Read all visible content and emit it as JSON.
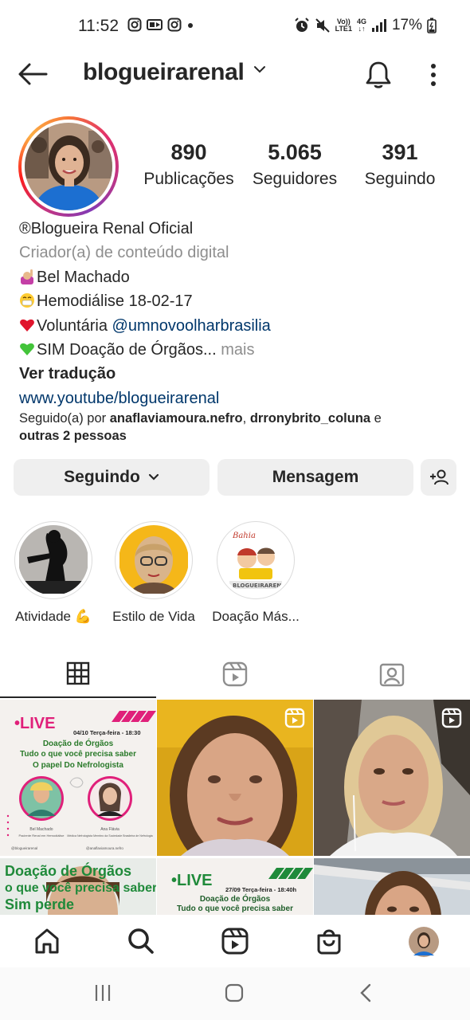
{
  "status_bar": {
    "time": "11:52",
    "battery": "17%",
    "net_top": "Vo))",
    "net_bottom": "LTE1",
    "net_4g": "4G"
  },
  "header": {
    "username": "blogueirarenal"
  },
  "profile": {
    "stats": [
      {
        "value": "890",
        "label": "Publicações"
      },
      {
        "value": "5.065",
        "label": "Seguidores"
      },
      {
        "value": "391",
        "label": "Seguindo"
      }
    ],
    "name": "®Blogueira Renal Oficial",
    "category": "Criador(a) de conteúdo digital",
    "bio_lines": [
      "Bel Machado",
      "Hemodiálise 18-02-17",
      "Voluntária ",
      "SIM Doação de Órgãos..."
    ],
    "bio_mention": "@umnovoolharbrasilia",
    "more": " mais",
    "translate": "Ver tradução",
    "website": "www.youtube/blogueirarenal",
    "followed_by_prefix": "Seguido(a) por ",
    "followed_by_user1": "anaflaviamoura.nefro",
    "followed_by_sep": ", ",
    "followed_by_user2": "drronybrito_coluna",
    "followed_by_and": " e",
    "followed_by_others": "outras 2 pessoas"
  },
  "buttons": {
    "following": "Seguindo",
    "message": "Mensagem"
  },
  "highlights": [
    {
      "label": "Atividade 💪"
    },
    {
      "label": "Estilo de Vida"
    },
    {
      "label": "Doação Más..."
    }
  ],
  "highlight3_text": {
    "top": "Bahia",
    "banner": "BLOGUEIRARENAL"
  },
  "grid": {
    "post1": {
      "live": "•LIVE",
      "date": "04/10 Terça-feira - 18:30",
      "line1": "Doação de Órgãos",
      "line2": "Tudo o que você precisa saber",
      "line3": "O papel Do Nefrologista",
      "caption_left": "Bel Machado",
      "caption_left2": "Paciente Renal em Hemodiálise",
      "caption_right": "Ana Flávia",
      "caption_right2": "Médica Nefrologista Membro da Sociedade Brasileira de Nefrologia",
      "handle_left": "@blogueirarenal",
      "handle_right": "@anaflaviamoura.nefro"
    },
    "post4": {
      "line1": "Doação de Órgãos",
      "line2": "o que você precisa saber",
      "line3": "Sim perde"
    },
    "post5": {
      "live": "•LIVE",
      "date": "27/09 Terça-feira - 18:40h",
      "line1": "Doação de Órgãos",
      "line2": "Tudo o que você precisa saber"
    }
  },
  "colors": {
    "text": "#262626",
    "secondary": "#8e8e8e",
    "link": "#00376b",
    "button_bg": "#efefef",
    "live_magenta": "#e0207a",
    "live_green": "#1f8a3a"
  }
}
